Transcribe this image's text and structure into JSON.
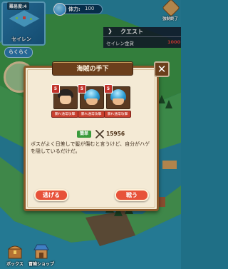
{
  "minimap": {
    "difficulty": "難易度:4",
    "island_name": "セイレン",
    "easy_label": "らくらく"
  },
  "stamina": {
    "label": "体力:",
    "value": "100"
  },
  "force_quit_label": "強制終了",
  "quest": {
    "title": "クエスト",
    "item": "セイレン金貨",
    "count": "1000"
  },
  "dialog": {
    "title": "海賊の手下",
    "enemies": [
      {
        "level": "5",
        "label": "暴れ通常攻撃"
      },
      {
        "level": "5",
        "label": "暴れ通常攻撃"
      },
      {
        "level": "5",
        "label": "暴れ通常攻撃"
      }
    ],
    "difficulty": "簡単",
    "exp": "15956",
    "description": "ボスがよく日差しで髪が傷むと言うけど、自分がハゲを隠しているだけだ。",
    "flee_label": "逃げる",
    "fight_label": "戦う"
  },
  "bottom": {
    "box_label": "ボックス",
    "shop_label": "冒険ショップ"
  },
  "colors": {
    "accent_red": "#e7523a",
    "dialog_bg": "#f4ead5",
    "frame_brown": "#8a5a2b",
    "badge_green": "#3a9b3c"
  }
}
